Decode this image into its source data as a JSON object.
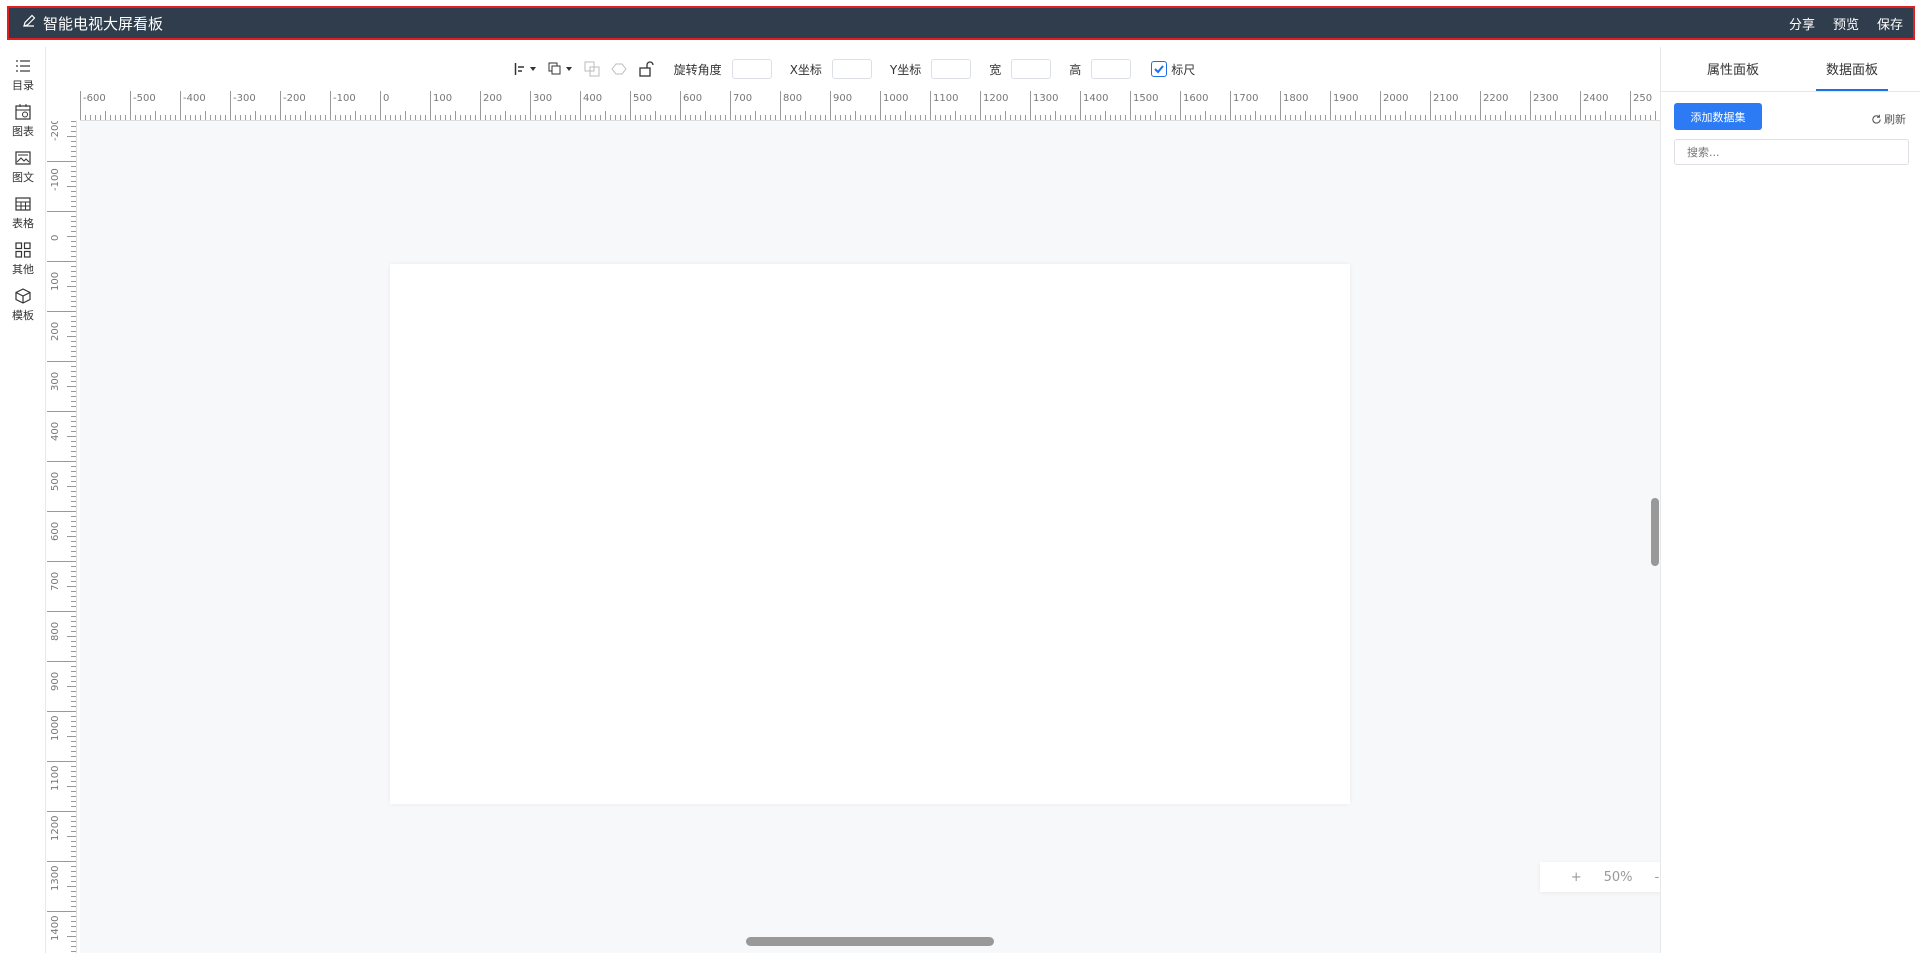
{
  "header": {
    "title": "智能电视大屏看板",
    "actions": [
      "分享",
      "预览",
      "保存"
    ]
  },
  "sidebar": {
    "items": [
      {
        "label": "目录",
        "icon": "list-icon"
      },
      {
        "label": "图表",
        "icon": "chart-calendar-icon"
      },
      {
        "label": "图文",
        "icon": "image-text-icon"
      },
      {
        "label": "表格",
        "icon": "table-icon"
      },
      {
        "label": "其他",
        "icon": "grid-icon"
      },
      {
        "label": "模板",
        "icon": "cube-icon"
      }
    ]
  },
  "toolbar": {
    "rotate_label": "旋转角度",
    "x_label": "X坐标",
    "y_label": "Y坐标",
    "width_label": "宽",
    "height_label": "高",
    "ruler_label": "标尺",
    "ruler_checked": true
  },
  "ruler": {
    "h_labels": [
      "-600",
      "-500",
      "-400",
      "-300",
      "-200",
      "-100",
      "0",
      "100",
      "200",
      "300",
      "400",
      "500",
      "600",
      "700",
      "800",
      "900",
      "1000",
      "1100",
      "1200",
      "1300",
      "1400",
      "1500",
      "1600",
      "1700",
      "1800",
      "1900",
      "2000",
      "2100",
      "2200",
      "2300",
      "2400",
      "250"
    ],
    "v_labels": [
      "-200",
      "-100",
      "0",
      "100",
      "200",
      "300",
      "400",
      "500",
      "600",
      "700",
      "800",
      "900",
      "1000",
      "1100",
      "1200",
      "1300",
      "1400"
    ]
  },
  "zoom": {
    "plus": "+",
    "level": "50%",
    "minus": "-"
  },
  "right_panel": {
    "tabs": [
      "属性面板",
      "数据面板"
    ],
    "active_tab": 1,
    "add_button": "添加数据集",
    "refresh_label": "刷新",
    "search_placeholder": "搜索..."
  },
  "colors": {
    "header_bg": "#2f3d4d",
    "accent": "#2d7bf4",
    "canvas_bg": "#f7f8fa"
  }
}
